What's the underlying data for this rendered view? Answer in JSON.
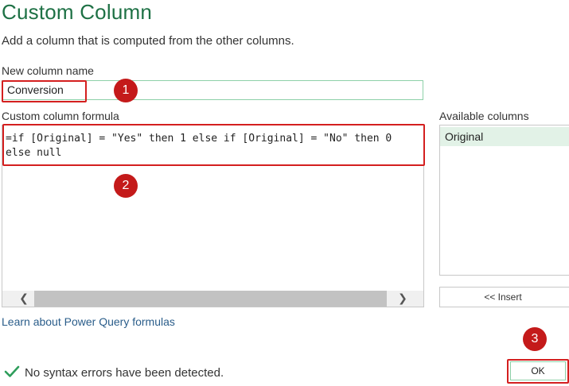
{
  "dialog": {
    "title": "Custom Column",
    "subtitle": "Add a column that is computed from the other columns."
  },
  "new_column": {
    "label": "New column name",
    "value": "Conversion"
  },
  "formula": {
    "label": "Custom column formula",
    "line1": "=if [Original] = \"Yes\" then 1 else if [Original] = \"No\" then 0",
    "line2": "else null"
  },
  "available_columns": {
    "label": "Available columns",
    "items": [
      "Original"
    ],
    "insert_label": "<< Insert"
  },
  "learn_link": "Learn about Power Query formulas",
  "status": {
    "text": "No syntax errors have been detected.",
    "icon": "check-icon"
  },
  "ok_label": "OK",
  "annotations": {
    "step1": "1",
    "step2": "2",
    "step3": "3"
  },
  "colors": {
    "accent_green": "#1e7145",
    "highlight_red": "#d41f1f",
    "step_badge": "#c41a1a",
    "link_blue": "#2a5d8a"
  }
}
